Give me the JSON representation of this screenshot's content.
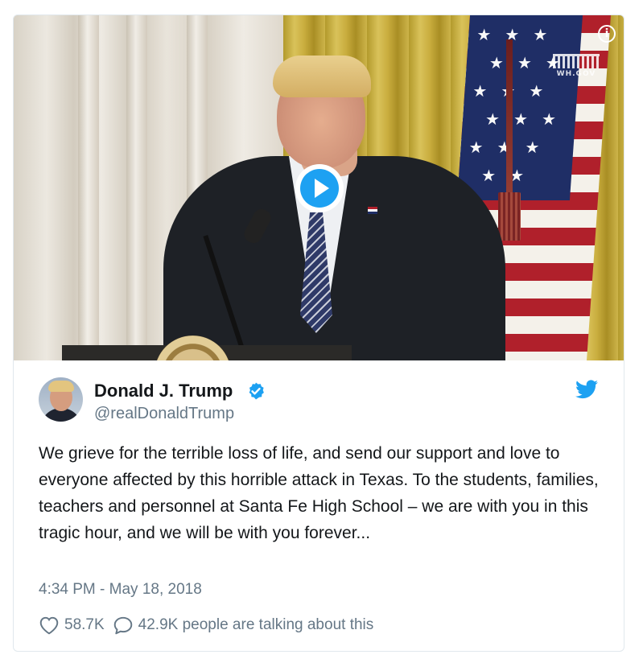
{
  "media": {
    "watermark": "WH.GOV",
    "info_icon": "info-icon",
    "play_icon": "play-icon",
    "colors": {
      "play_accent": "#1da1f2"
    }
  },
  "tweet": {
    "author_name": "Donald J. Trump",
    "handle": "@realDonaldTrump",
    "verified_icon": "verified-badge-icon",
    "brand_icon": "twitter-bird-icon",
    "text": "We grieve for the terrible loss of life, and send our support and love to everyone affected by this horrible attack in Texas. To the students, families, teachers and personnel at Santa Fe High School – we are with you in this tragic hour, and we will be with you forever...",
    "timestamp": "4:34 PM - May 18, 2018",
    "likes": "58.7K",
    "conversation": "42.9K people are talking about this"
  },
  "colors": {
    "brand_blue": "#1da1f2",
    "secondary_text": "#657786",
    "primary_text": "#14171a",
    "border": "#e1e8ed"
  }
}
